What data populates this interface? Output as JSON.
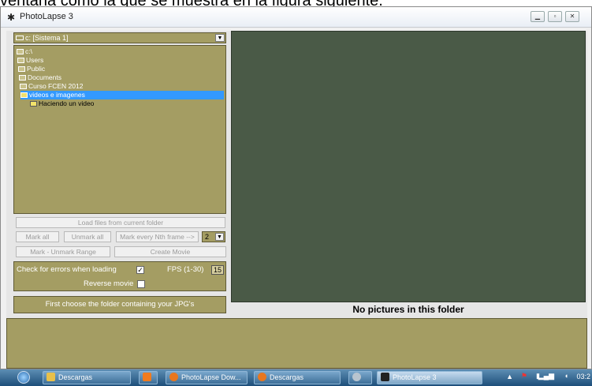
{
  "document_text": "ventana como la que se muestra en la figura siguiente.",
  "window": {
    "title": "PhotoLapse 3",
    "controls": [
      "minimize",
      "maximize",
      "close"
    ]
  },
  "drive_select": {
    "value": "c: [Sistema 1]"
  },
  "folder_tree": [
    {
      "label": "c:\\",
      "indent": 0
    },
    {
      "label": "Users",
      "indent": 1
    },
    {
      "label": "Public",
      "indent": 2
    },
    {
      "label": "Documents",
      "indent": 3
    },
    {
      "label": "Curso FCEN 2012",
      "indent": 4
    },
    {
      "label": "videos e imagenes",
      "indent": 5,
      "selected": true
    },
    {
      "label": "Haciendo un video",
      "indent": 6
    }
  ],
  "buttons": {
    "load_files": "Load files from current folder",
    "mark_all": "Mark all",
    "unmark_all": "Unmark all",
    "mark_every_nth": "Mark every Nth frame -->",
    "mark_unmark_range": "Mark - Unmark Range",
    "create_movie": "Create Movie"
  },
  "nth_select": {
    "value": "2"
  },
  "options": {
    "check_errors_label": "Check for errors when loading",
    "check_errors_checked": true,
    "fps_label": "FPS (1-30)",
    "fps_value": "15",
    "reverse_label": "Reverse movie",
    "reverse_checked": false
  },
  "status": {
    "left": "First choose the folder containing your JPG's",
    "preview": "No pictures in this folder"
  },
  "taskbar": {
    "items": [
      {
        "label": "Descargas",
        "active": false
      },
      {
        "label": "",
        "active": false
      },
      {
        "label": "PhotoLapse Dow...",
        "active": false
      },
      {
        "label": "Descargas",
        "active": false
      },
      {
        "label": "",
        "active": false
      },
      {
        "label": "PhotoLapse 3",
        "active": true
      }
    ],
    "clock": "03:2"
  },
  "colors": {
    "panel": "#a49d63",
    "preview": "#4a5a47",
    "selection": "#3399ff",
    "taskbar": "#1d4e7a"
  }
}
